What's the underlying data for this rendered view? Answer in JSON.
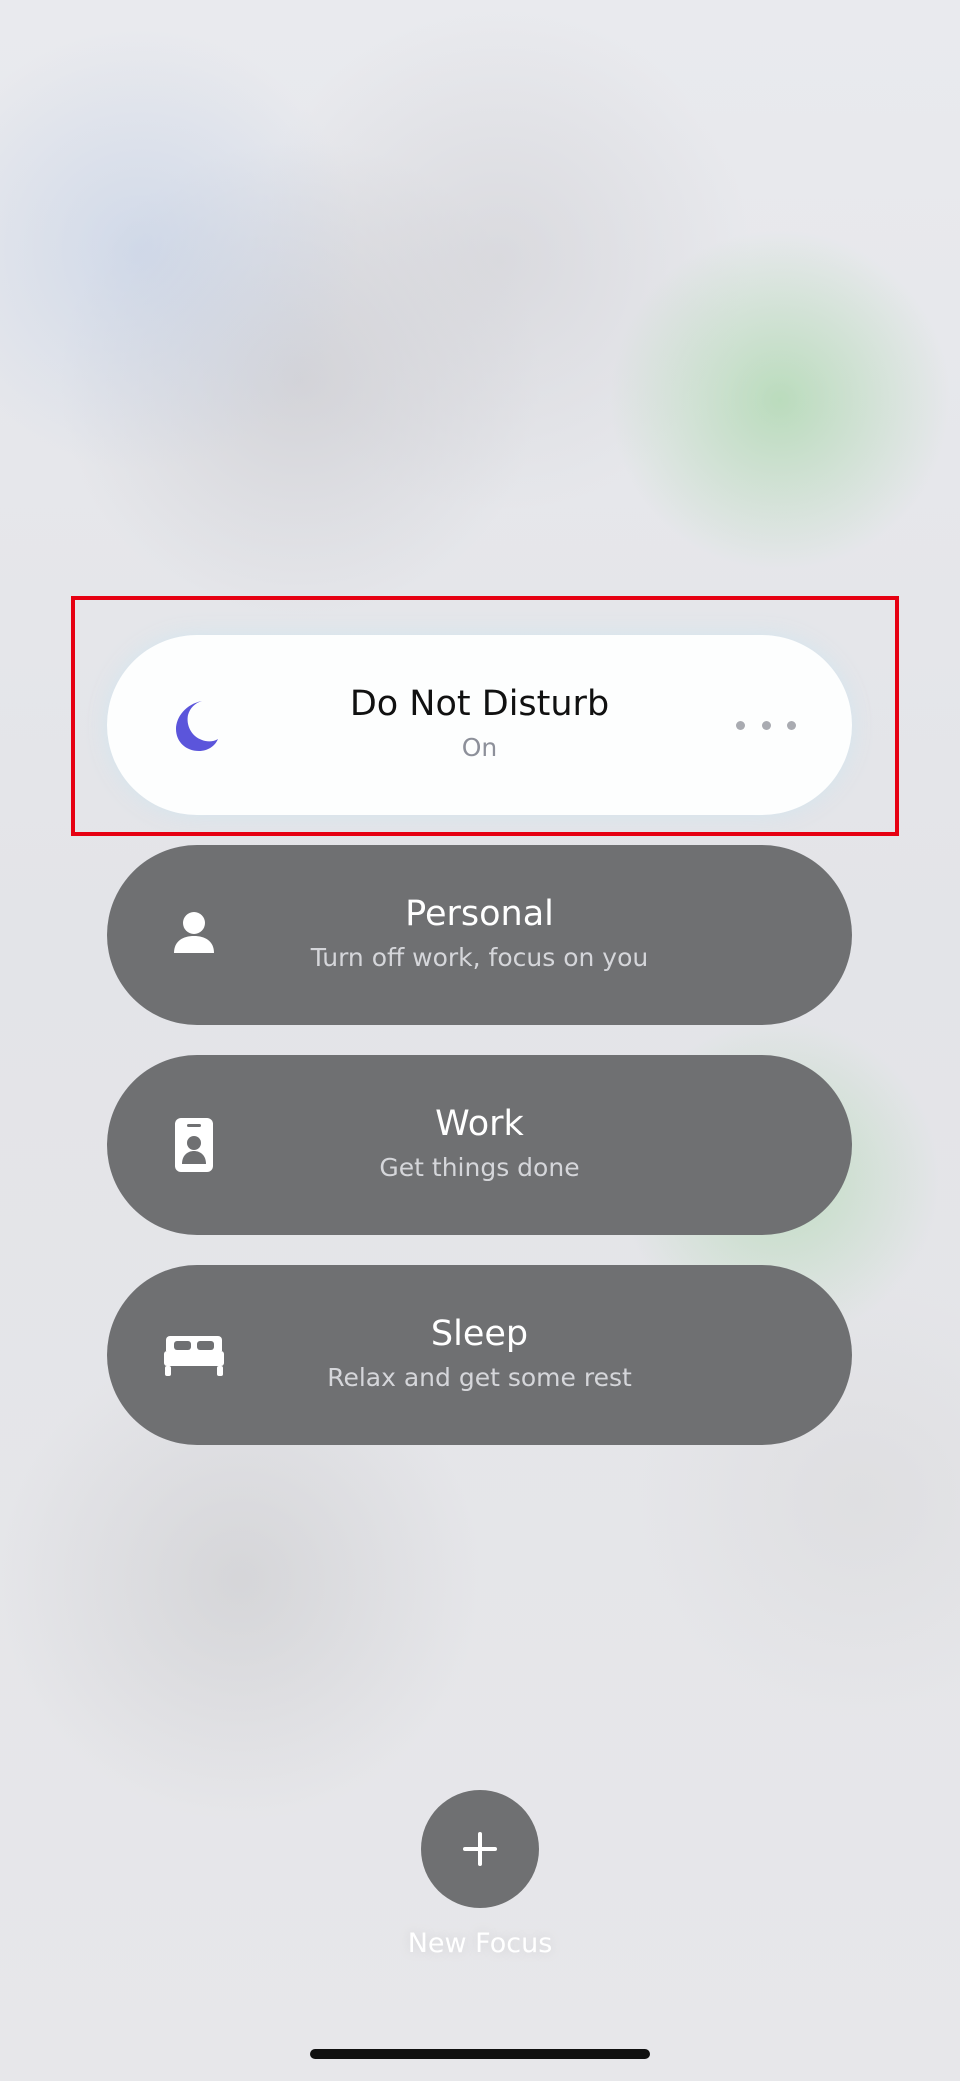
{
  "focus_modes": [
    {
      "title": "Do Not Disturb",
      "subtitle": "On",
      "icon": "moon-icon",
      "active": true
    },
    {
      "title": "Personal",
      "subtitle": "Turn off work, focus on you",
      "icon": "person-icon",
      "active": false
    },
    {
      "title": "Work",
      "subtitle": "Get things done",
      "icon": "work-badge-icon",
      "active": false
    },
    {
      "title": "Sleep",
      "subtitle": "Relax and get some rest",
      "icon": "bed-icon",
      "active": false
    }
  ],
  "more_button_icon": "more-icon",
  "new_focus": {
    "label": "New Focus",
    "icon": "plus-icon"
  },
  "colors": {
    "moon_icon": "#5b55db",
    "active_card": "#fdfefe",
    "inactive_card": "#6f7072",
    "selection_outline": "#e60012"
  }
}
